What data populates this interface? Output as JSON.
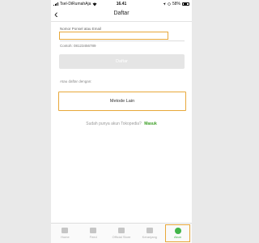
{
  "status_bar": {
    "carrier": "Tsel-DiRumahAja",
    "time": "16.41",
    "battery": "58%"
  },
  "header": {
    "back_icon": "chevron-left-icon",
    "title": "Daftar"
  },
  "form": {
    "label": "Nomor Ponsel atau Email",
    "value": "",
    "hint": "Contoh: 08123456789",
    "submit_label": "Daftar"
  },
  "alternative": {
    "label": "Atau daftar dengan:",
    "button_label": "Metode Lain"
  },
  "login_prompt": {
    "text": "Sudah punya akun Tokopedia?",
    "link_label": "Masuk"
  },
  "tabbar": {
    "items": [
      {
        "label": "Home",
        "icon": "home-icon"
      },
      {
        "label": "Feed",
        "icon": "feed-icon"
      },
      {
        "label": "Official Store",
        "icon": "official-store-icon"
      },
      {
        "label": "Keranjang",
        "icon": "cart-icon"
      },
      {
        "label": "Akun",
        "icon": "account-icon",
        "active": true
      }
    ]
  },
  "colors": {
    "accent": "#42b549",
    "highlight": "#e8a83a"
  }
}
